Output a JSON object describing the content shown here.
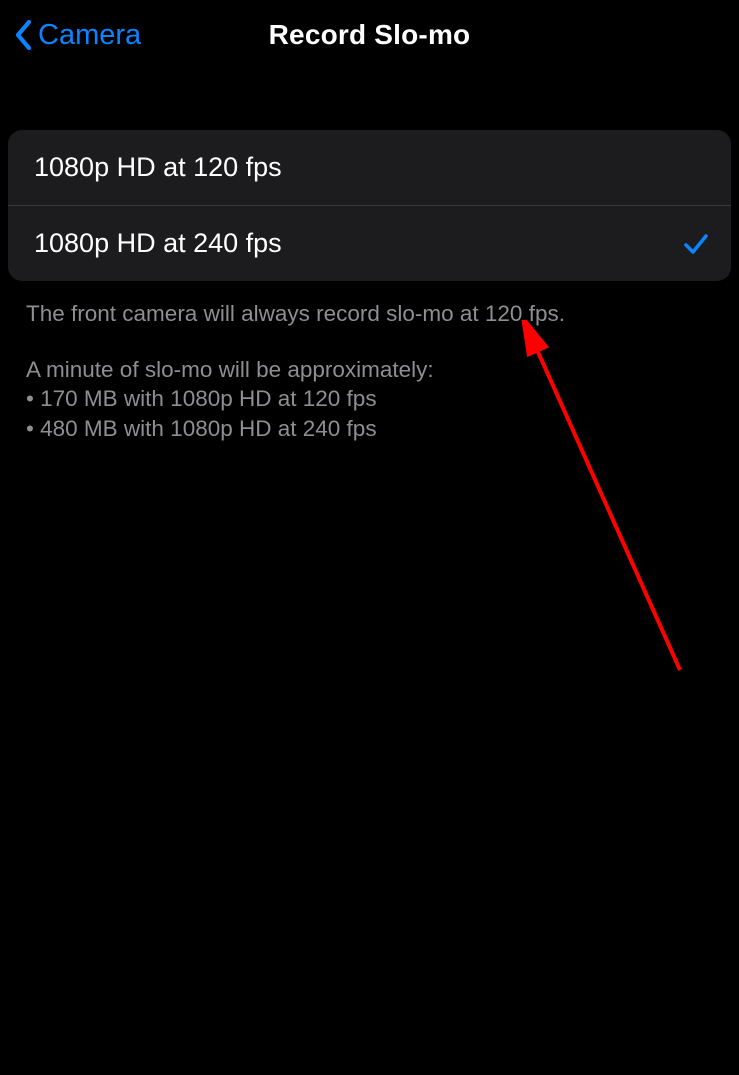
{
  "header": {
    "back_label": "Camera",
    "title": "Record Slo-mo"
  },
  "options": [
    {
      "label": "1080p HD at 120 fps",
      "selected": false
    },
    {
      "label": "1080p HD at 240 fps",
      "selected": true
    }
  ],
  "footer": {
    "line1": "The front camera will always record slo-mo at 120 fps.",
    "line2": "A minute of slo-mo will be approximately:",
    "bullet1": "• 170 MB with 1080p HD at 120 fps",
    "bullet2": "• 480 MB with 1080p HD at 240 fps"
  },
  "colors": {
    "accent": "#0a84ff",
    "arrow": "#ff0000"
  }
}
